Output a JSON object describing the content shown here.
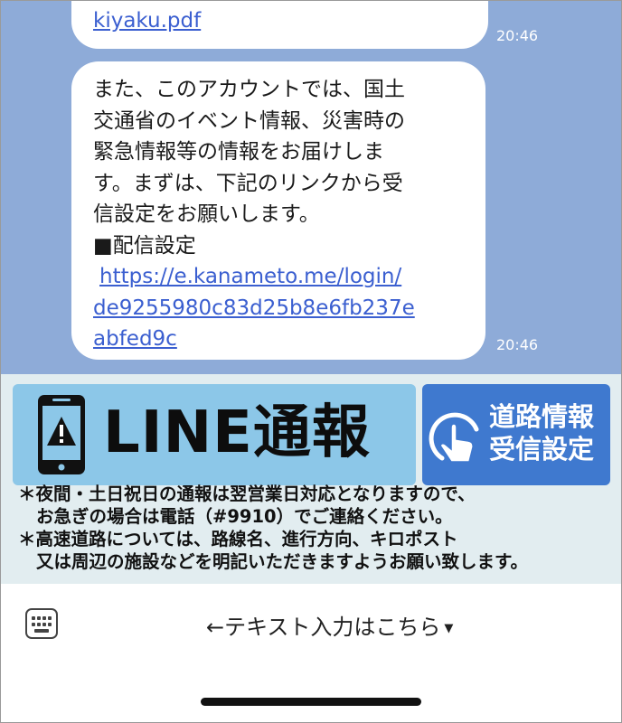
{
  "chat": {
    "messages": [
      {
        "id": "terms-link",
        "link_text": "kiyaku.pdf",
        "time": "20:46"
      },
      {
        "id": "intro",
        "lines": [
          "また、このアカウントでは、国土",
          "交通省のイベント情報、災害時の",
          "緊急情報等の情報をお届けしま",
          "す。まずは、下記のリンクから受",
          "信設定をお願いします。",
          "■配信設定"
        ],
        "link_lines": [
          "https://e.kanameto.me/login/",
          "de9255980c83d25b8e6fb237e",
          "abfed9c"
        ],
        "time": "20:46"
      }
    ]
  },
  "rich_menu": {
    "line_report_button": {
      "label": "LINE通報",
      "icon": "phone-warning-icon"
    },
    "road_info_button": {
      "label_line1": "道路情報",
      "label_line2": "受信設定",
      "icon": "tap-hand-icon"
    },
    "notes": [
      "＊夜間・土日祝日の通報は翌営業日対応となりますので、",
      "お急ぎの場合は電話（#9910）でご連絡ください。",
      "＊高速道路については、路線名、進行方向、キロポスト",
      "又は周辺の施設などを明記いただきますようお願い致します。"
    ]
  },
  "input_bar": {
    "keyboard_icon": "keyboard-icon",
    "menu_toggle_label": "←テキスト入力はこちら"
  },
  "colors": {
    "chat_background": "#8eabd8",
    "rich_menu_background": "#e2edf0",
    "line_button": "#8cc7e8",
    "road_button": "#3f79cf",
    "link": "#3b5fd0"
  }
}
